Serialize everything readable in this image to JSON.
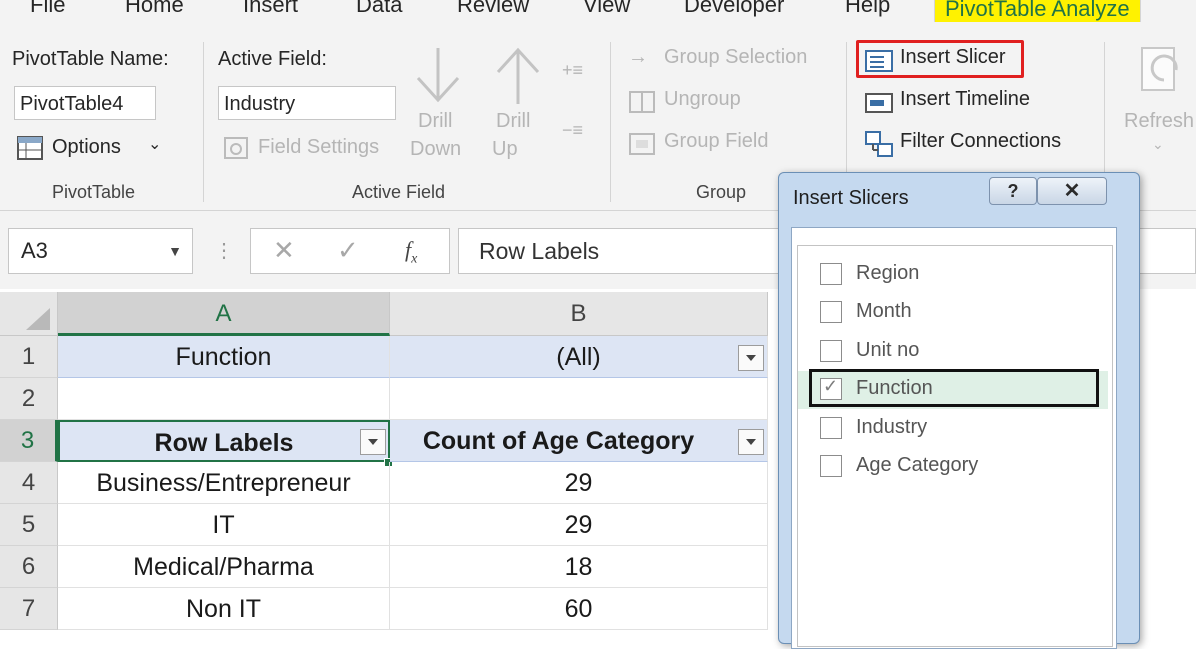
{
  "tabs": [
    "File",
    "Home",
    "Insert",
    "Data",
    "Review",
    "View",
    "Developer",
    "Help",
    "PivotTable Analyze"
  ],
  "ribbon": {
    "pivottable_name_label": "PivotTable Name:",
    "pivottable_name_value": "PivotTable4",
    "options_label": "Options",
    "group_pivottable": "PivotTable",
    "active_field_label": "Active Field:",
    "active_field_value": "Industry",
    "field_settings": "Field Settings",
    "drill_down_1": "Drill",
    "drill_down_2": "Down",
    "drill_up_1": "Drill",
    "drill_up_2": "Up",
    "group_active_field": "Active Field",
    "group_selection": "Group Selection",
    "ungroup": "Ungroup",
    "group_field": "Group Field",
    "group_group": "Group",
    "insert_slicer": "Insert Slicer",
    "insert_timeline": "Insert Timeline",
    "filter_connections": "Filter Connections",
    "refresh": "Refresh"
  },
  "formula_bar": {
    "name_box": "A3",
    "formula": "Row Labels"
  },
  "grid": {
    "columns": [
      "A",
      "B"
    ],
    "rows": [
      "1",
      "2",
      "3",
      "4",
      "5",
      "6",
      "7"
    ],
    "filter_label": "Function",
    "filter_value": "(All)",
    "header_a": "Row Labels",
    "header_b": "Count of Age Category",
    "data": [
      {
        "label": "Business/Entrepreneur",
        "count": "29"
      },
      {
        "label": "IT",
        "count": "29"
      },
      {
        "label": "Medical/Pharma",
        "count": "18"
      },
      {
        "label": "Non IT",
        "count": "60"
      }
    ]
  },
  "dialog": {
    "title": "Insert Slicers",
    "help": "?",
    "close": "✕",
    "options": [
      {
        "label": "Region",
        "checked": false
      },
      {
        "label": "Month",
        "checked": false
      },
      {
        "label": "Unit no",
        "checked": false
      },
      {
        "label": "Function",
        "checked": true
      },
      {
        "label": "Industry",
        "checked": false
      },
      {
        "label": "Age Category",
        "checked": false
      }
    ]
  }
}
